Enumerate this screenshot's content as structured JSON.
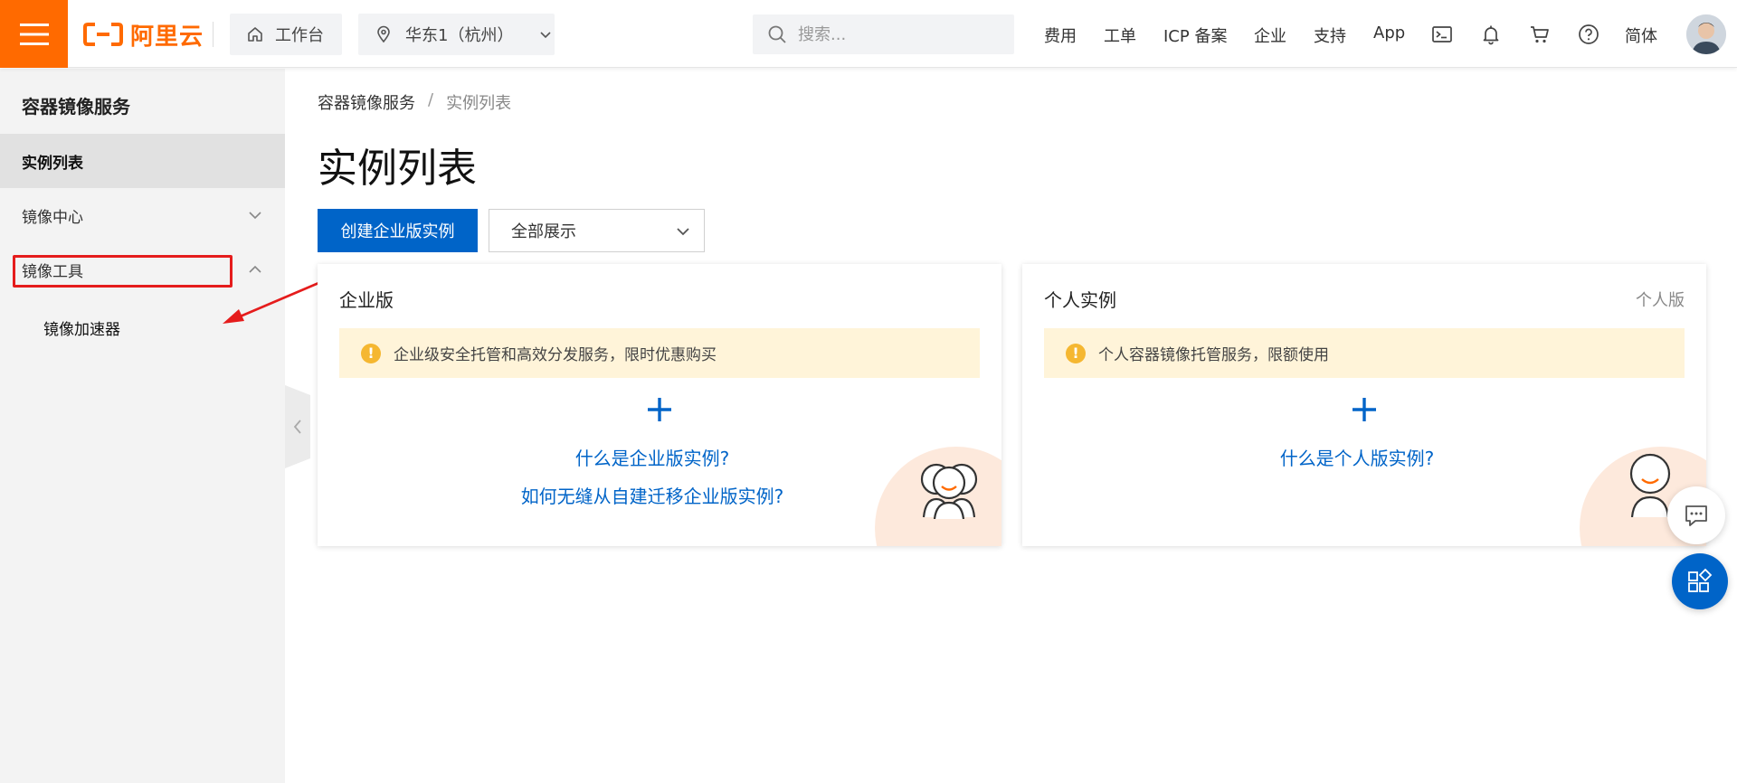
{
  "header": {
    "logo_text": "阿里云",
    "workbench_label": "工作台",
    "region_label": "华东1（杭州）",
    "search_placeholder": "搜索...",
    "nav": {
      "fees": "费用",
      "tickets": "工单",
      "icp": "ICP 备案",
      "enterprise": "企业",
      "support": "支持",
      "app": "App",
      "language": "简体"
    }
  },
  "sidebar": {
    "title": "容器镜像服务",
    "items": [
      {
        "label": "实例列表"
      },
      {
        "label": "镜像中心"
      },
      {
        "label": "镜像工具"
      }
    ],
    "sub_items": [
      {
        "label": "镜像加速器"
      }
    ]
  },
  "breadcrumb": {
    "root": "容器镜像服务",
    "separator": "/",
    "current": "实例列表"
  },
  "main": {
    "title": "实例列表",
    "create_button": "创建企业版实例",
    "filter_select": "全部展示"
  },
  "cards": {
    "enterprise": {
      "title": "企业版",
      "notice": "企业级安全托管和高效分发服务，限时优惠购买",
      "link1": "什么是企业版实例?",
      "link2": "如何无缝从自建迁移企业版实例?"
    },
    "personal": {
      "title": "个人实例",
      "tag": "个人版",
      "notice": "个人容器镜像托管服务，限额使用",
      "link1": "什么是个人版实例?"
    }
  },
  "colors": {
    "brand_orange": "#ff6a00",
    "primary_blue": "#0064c8",
    "annotation_red": "#e51c1c",
    "notice_bg": "#fff4d9"
  }
}
